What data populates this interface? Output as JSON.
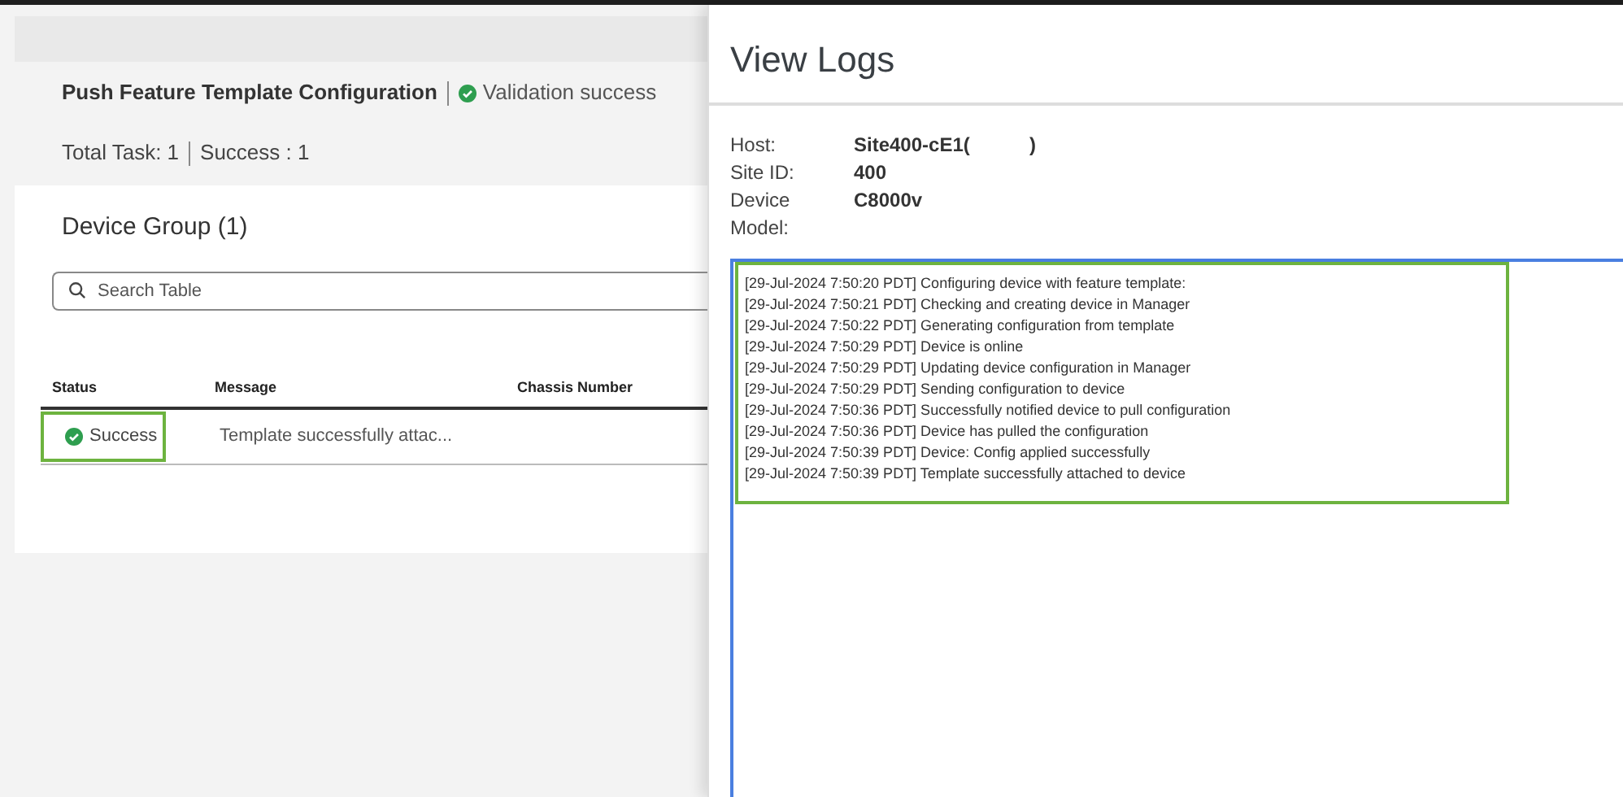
{
  "page": {
    "title": "Push Feature Template Configuration",
    "validation": "Validation success",
    "summary": [
      "Total Task: 1",
      "Success : 1"
    ]
  },
  "device_group": {
    "title": "Device Group (1)",
    "search": {
      "placeholder": "Search Table"
    },
    "table": {
      "columns": [
        "Status",
        "Message",
        "Chassis Number"
      ],
      "rows": [
        {
          "status": "Success",
          "highlighted": true,
          "message": "Template successfully attac..."
        }
      ]
    }
  },
  "drawer": {
    "title": "View Logs",
    "details": [
      {
        "label": "Host:",
        "value": "Site400-cE1(           )"
      },
      {
        "label": "Site ID:",
        "value": "400"
      },
      {
        "label": "Device Model:",
        "value": "C8000v"
      }
    ],
    "logs_highlighted": true,
    "logs": [
      "[29-Jul-2024 7:50:20 PDT] Configuring device with feature template:",
      "[29-Jul-2024 7:50:21 PDT] Checking and creating device in Manager",
      "[29-Jul-2024 7:50:22 PDT] Generating configuration from template",
      "[29-Jul-2024 7:50:29 PDT] Device is online",
      "[29-Jul-2024 7:50:29 PDT] Updating device configuration in Manager",
      "[29-Jul-2024 7:50:29 PDT] Sending configuration to device",
      "[29-Jul-2024 7:50:36 PDT] Successfully notified device to pull configuration",
      "[29-Jul-2024 7:50:36 PDT] Device has pulled the configuration",
      "[29-Jul-2024 7:50:39 PDT] Device: Config applied successfully",
      "[29-Jul-2024 7:50:39 PDT] Template successfully attached to device"
    ]
  }
}
